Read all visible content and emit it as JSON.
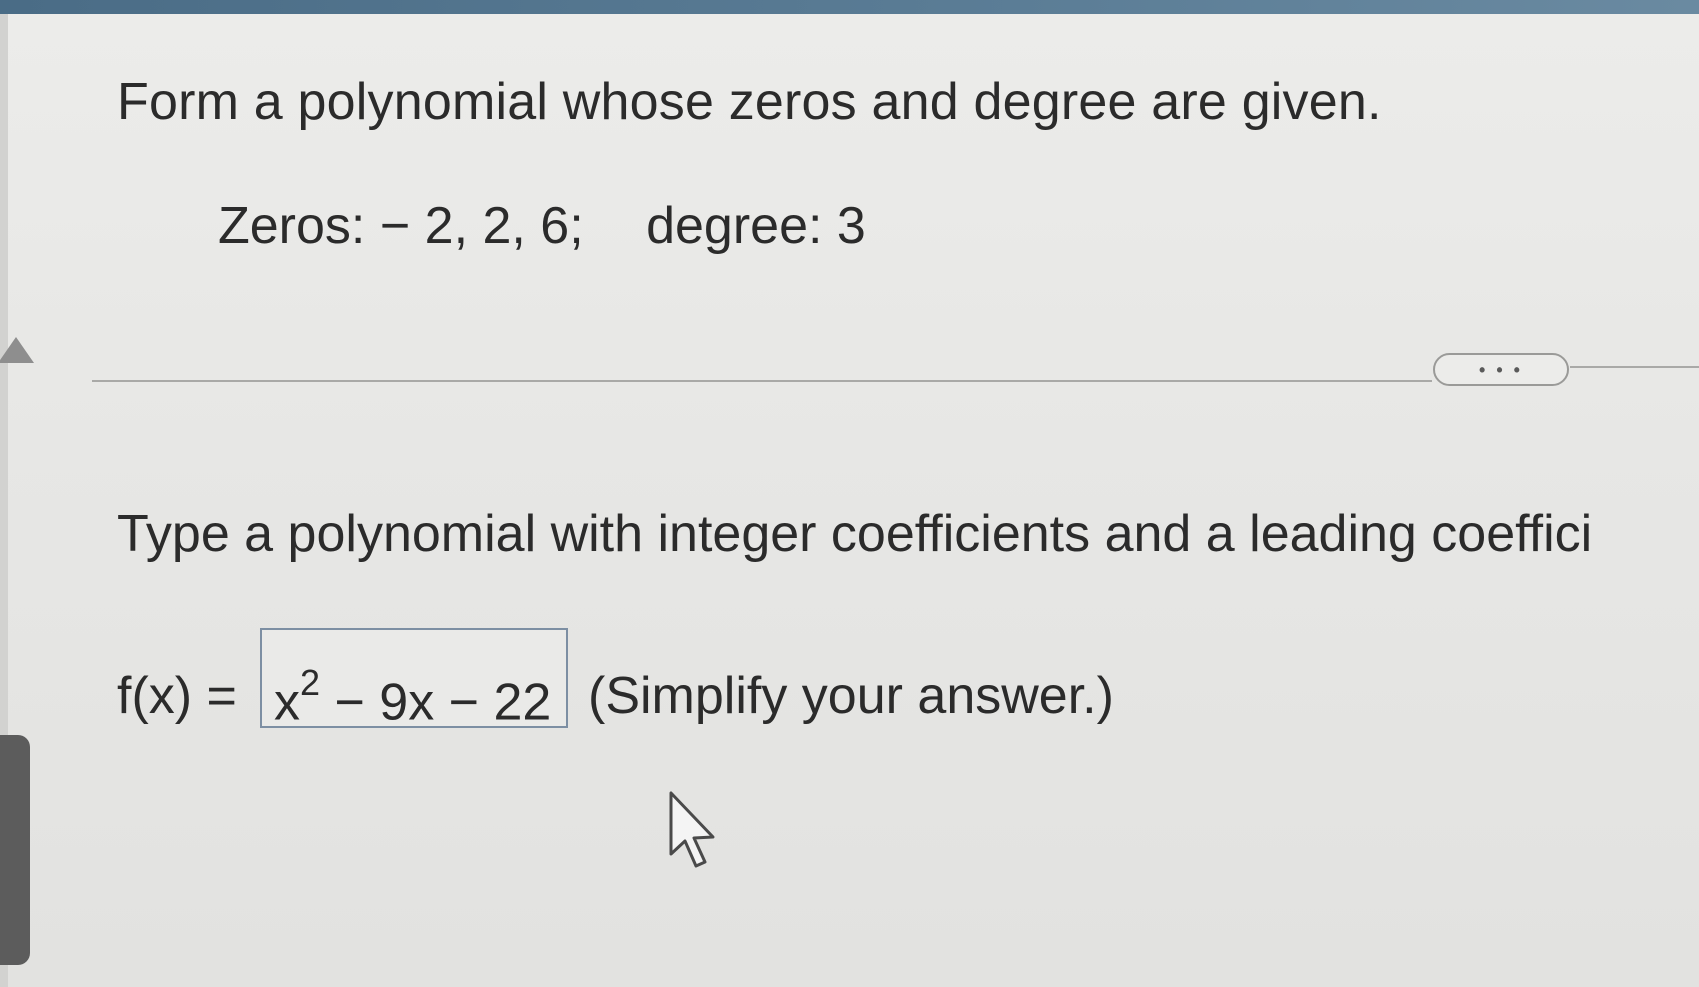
{
  "question": {
    "title": "Form a polynomial whose zeros and degree are given.",
    "zeros_label": "Zeros:",
    "zeros_value": "− 2, 2, 6;",
    "degree_label": "degree:",
    "degree_value": "3"
  },
  "more_button": {
    "label": "• • •"
  },
  "answer_section": {
    "instruction": "Type a polynomial with integer coefficients and a leading coeffici",
    "function_label": "f(x) =",
    "answer_base": "x",
    "answer_exponent": "2",
    "answer_rest": " − 9x − 22",
    "hint": "(Simplify your answer.)"
  },
  "colors": {
    "top_bar": "#4a6c86",
    "answer_box_border": "#7d8fa3",
    "text": "#2b2b2b"
  },
  "icons": {
    "cursor": "arrow-cursor-icon",
    "collapse": "collapse-triangle-icon"
  }
}
